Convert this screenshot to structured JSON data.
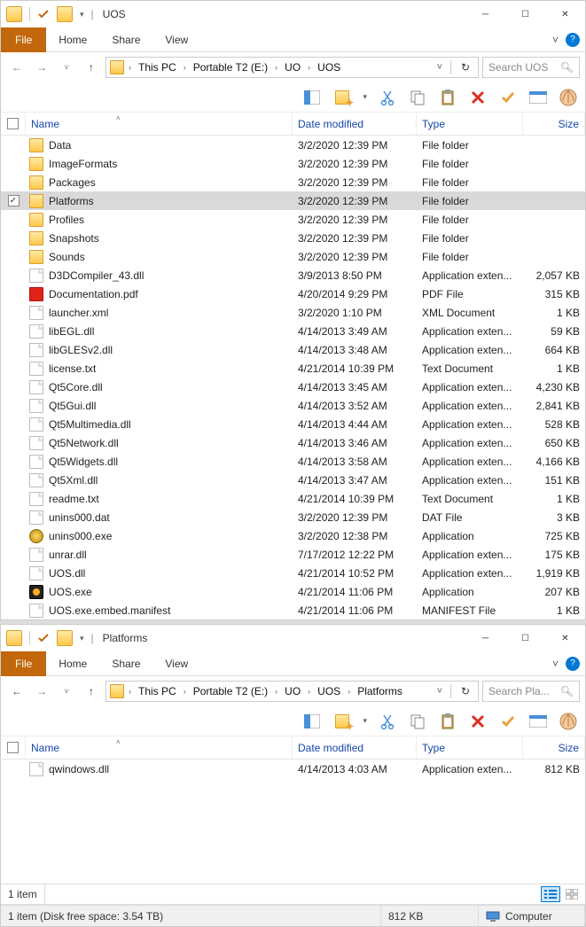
{
  "window1": {
    "title": "UOS",
    "tabs": {
      "file": "File",
      "home": "Home",
      "share": "Share",
      "view": "View"
    },
    "breadcrumbs": [
      "This PC",
      "Portable T2 (E:)",
      "UO",
      "UOS"
    ],
    "search_placeholder": "Search UOS",
    "columns": {
      "name": "Name",
      "date": "Date modified",
      "type": "Type",
      "size": "Size"
    },
    "files": [
      {
        "icon": "folder",
        "name": "Data",
        "date": "3/2/2020 12:39 PM",
        "type": "File folder",
        "size": "",
        "sel": false
      },
      {
        "icon": "folder",
        "name": "ImageFormats",
        "date": "3/2/2020 12:39 PM",
        "type": "File folder",
        "size": "",
        "sel": false
      },
      {
        "icon": "folder",
        "name": "Packages",
        "date": "3/2/2020 12:39 PM",
        "type": "File folder",
        "size": "",
        "sel": false
      },
      {
        "icon": "folder",
        "name": "Platforms",
        "date": "3/2/2020 12:39 PM",
        "type": "File folder",
        "size": "",
        "sel": true
      },
      {
        "icon": "folder",
        "name": "Profiles",
        "date": "3/2/2020 12:39 PM",
        "type": "File folder",
        "size": "",
        "sel": false
      },
      {
        "icon": "folder",
        "name": "Snapshots",
        "date": "3/2/2020 12:39 PM",
        "type": "File folder",
        "size": "",
        "sel": false
      },
      {
        "icon": "folder",
        "name": "Sounds",
        "date": "3/2/2020 12:39 PM",
        "type": "File folder",
        "size": "",
        "sel": false
      },
      {
        "icon": "file",
        "name": "D3DCompiler_43.dll",
        "date": "3/9/2013 8:50 PM",
        "type": "Application exten...",
        "size": "2,057 KB",
        "sel": false
      },
      {
        "icon": "pdf",
        "name": "Documentation.pdf",
        "date": "4/20/2014 9:29 PM",
        "type": "PDF File",
        "size": "315 KB",
        "sel": false
      },
      {
        "icon": "file",
        "name": "launcher.xml",
        "date": "3/2/2020 1:10 PM",
        "type": "XML Document",
        "size": "1 KB",
        "sel": false
      },
      {
        "icon": "file",
        "name": "libEGL.dll",
        "date": "4/14/2013 3:49 AM",
        "type": "Application exten...",
        "size": "59 KB",
        "sel": false
      },
      {
        "icon": "file",
        "name": "libGLESv2.dll",
        "date": "4/14/2013 3:48 AM",
        "type": "Application exten...",
        "size": "664 KB",
        "sel": false
      },
      {
        "icon": "file",
        "name": "license.txt",
        "date": "4/21/2014 10:39 PM",
        "type": "Text Document",
        "size": "1 KB",
        "sel": false
      },
      {
        "icon": "file",
        "name": "Qt5Core.dll",
        "date": "4/14/2013 3:45 AM",
        "type": "Application exten...",
        "size": "4,230 KB",
        "sel": false
      },
      {
        "icon": "file",
        "name": "Qt5Gui.dll",
        "date": "4/14/2013 3:52 AM",
        "type": "Application exten...",
        "size": "2,841 KB",
        "sel": false
      },
      {
        "icon": "file",
        "name": "Qt5Multimedia.dll",
        "date": "4/14/2013 4:44 AM",
        "type": "Application exten...",
        "size": "528 KB",
        "sel": false
      },
      {
        "icon": "file",
        "name": "Qt5Network.dll",
        "date": "4/14/2013 3:46 AM",
        "type": "Application exten...",
        "size": "650 KB",
        "sel": false
      },
      {
        "icon": "file",
        "name": "Qt5Widgets.dll",
        "date": "4/14/2013 3:58 AM",
        "type": "Application exten...",
        "size": "4,166 KB",
        "sel": false
      },
      {
        "icon": "file",
        "name": "Qt5Xml.dll",
        "date": "4/14/2013 3:47 AM",
        "type": "Application exten...",
        "size": "151 KB",
        "sel": false
      },
      {
        "icon": "file",
        "name": "readme.txt",
        "date": "4/21/2014 10:39 PM",
        "type": "Text Document",
        "size": "1 KB",
        "sel": false
      },
      {
        "icon": "file",
        "name": "unins000.dat",
        "date": "3/2/2020 12:39 PM",
        "type": "DAT File",
        "size": "3 KB",
        "sel": false
      },
      {
        "icon": "exe",
        "name": "unins000.exe",
        "date": "3/2/2020 12:38 PM",
        "type": "Application",
        "size": "725 KB",
        "sel": false
      },
      {
        "icon": "file",
        "name": "unrar.dll",
        "date": "7/17/2012 12:22 PM",
        "type": "Application exten...",
        "size": "175 KB",
        "sel": false
      },
      {
        "icon": "file",
        "name": "UOS.dll",
        "date": "4/21/2014 10:52 PM",
        "type": "Application exten...",
        "size": "1,919 KB",
        "sel": false
      },
      {
        "icon": "exe2",
        "name": "UOS.exe",
        "date": "4/21/2014 11:06 PM",
        "type": "Application",
        "size": "207 KB",
        "sel": false
      },
      {
        "icon": "file",
        "name": "UOS.exe.embed.manifest",
        "date": "4/21/2014 11:06 PM",
        "type": "MANIFEST File",
        "size": "1 KB",
        "sel": false
      }
    ]
  },
  "window2": {
    "title": "Platforms",
    "tabs": {
      "file": "File",
      "home": "Home",
      "share": "Share",
      "view": "View"
    },
    "breadcrumbs": [
      "This PC",
      "Portable T2 (E:)",
      "UO",
      "UOS",
      "Platforms"
    ],
    "search_placeholder": "Search Pla...",
    "columns": {
      "name": "Name",
      "date": "Date modified",
      "type": "Type",
      "size": "Size"
    },
    "files": [
      {
        "icon": "file",
        "name": "qwindows.dll",
        "date": "4/14/2013 4:03 AM",
        "type": "Application exten...",
        "size": "812 KB",
        "sel": false
      }
    ],
    "status_items": "1 item",
    "status_full": "1 item (Disk free space: 3.54 TB)",
    "status_size": "812 KB",
    "status_loc": "Computer"
  }
}
